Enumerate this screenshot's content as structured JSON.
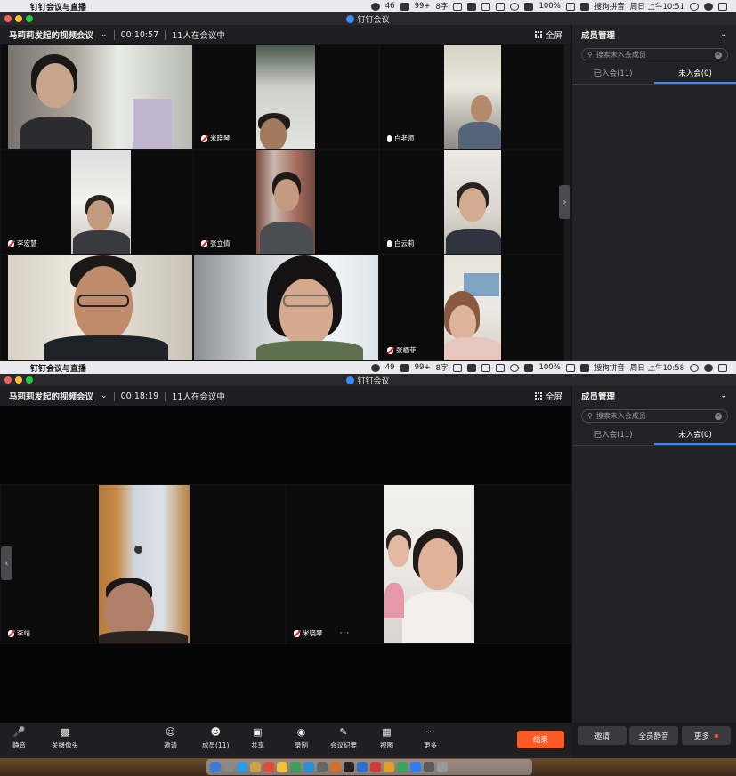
{
  "screen1": {
    "menubar": {
      "app_name": "钉钉会议与直播",
      "wechat_count": "46",
      "badge": "99+",
      "word_count": "8字",
      "battery": "100%",
      "input_method": "搜狗拼音",
      "clock": "周日 上午10:51"
    },
    "window_title": "钉钉会议",
    "toolbar": {
      "meeting_title": "马莉莉发起的视频会议",
      "timer": "00:10:57",
      "participants": "11人在会议中",
      "fullscreen": "全屏"
    },
    "panel": {
      "title": "成员管理",
      "search_placeholder": "搜索未入会成员",
      "tab_joined": "已入会(11)",
      "tab_not_joined": "未入会(0)"
    },
    "tiles": {
      "t2": "米晓琴",
      "t3": "白老师",
      "t4": "李宏慧",
      "t5": "张立倩",
      "t6": "白云莉",
      "t9": "张栖菲"
    }
  },
  "screen2": {
    "menubar": {
      "app_name": "钉钉会议与直播",
      "wechat_count": "49",
      "badge": "99+",
      "word_count": "8字",
      "battery": "100%",
      "input_method": "搜狗拼音",
      "clock": "周日 上午10:58"
    },
    "window_title": "钉钉会议",
    "toolbar": {
      "meeting_title": "马莉莉发起的视频会议",
      "timer": "00:18:19",
      "participants": "11人在会议中",
      "fullscreen": "全屏"
    },
    "panel": {
      "title": "成员管理",
      "search_placeholder": "搜索未入会成员",
      "tab_joined": "已入会(11)",
      "tab_not_joined": "未入会(0)"
    },
    "tiles": {
      "left": "李靖",
      "right": "米晓琴"
    },
    "controls": {
      "mute": "静音",
      "camera": "关摄像头",
      "invite": "邀请",
      "members": "成员(11)",
      "share": "共享",
      "record": "录制",
      "minutes": "会议纪要",
      "view": "视图",
      "more": "更多",
      "end": "结束"
    },
    "panel_buttons": {
      "invite": "邀请",
      "mute_all": "全员静音",
      "more": "更多"
    }
  }
}
